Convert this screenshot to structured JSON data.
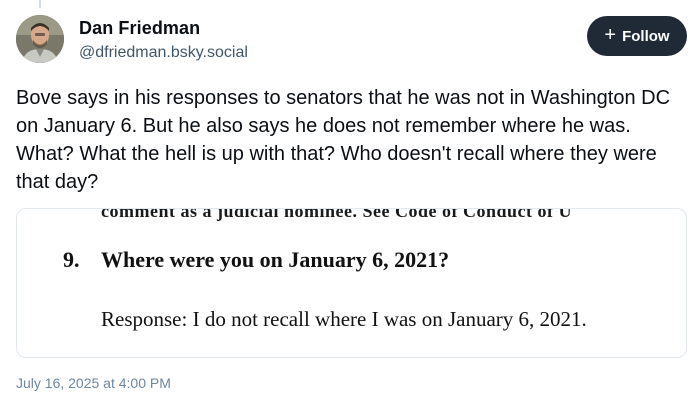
{
  "author": {
    "display_name": "Dan Friedman",
    "handle": "@dfriedman.bsky.social",
    "avatar_icon": "user-avatar-photo"
  },
  "follow_button": {
    "icon": "plus-icon",
    "label": "Follow"
  },
  "post": {
    "text": "Bove says in his responses to senators that he was not in Washington DC on January 6. But he also says he does not remember where he was. What? What the hell is up with that? Who doesn't recall where they were that day?",
    "timestamp": "July 16, 2025 at 4:00 PM"
  },
  "embed": {
    "cut_line": "comment as a judicial nominee. See Code of Conduct of U",
    "question_number": "9.",
    "question": "Where were you on January 6, 2021?",
    "response": "Response: I do not recall where I was on January 6, 2021."
  },
  "colors": {
    "follow_bg": "#1f2a36",
    "handle": "#42576c",
    "timestamp": "#6f869f",
    "card_border": "#e3e8ed"
  }
}
